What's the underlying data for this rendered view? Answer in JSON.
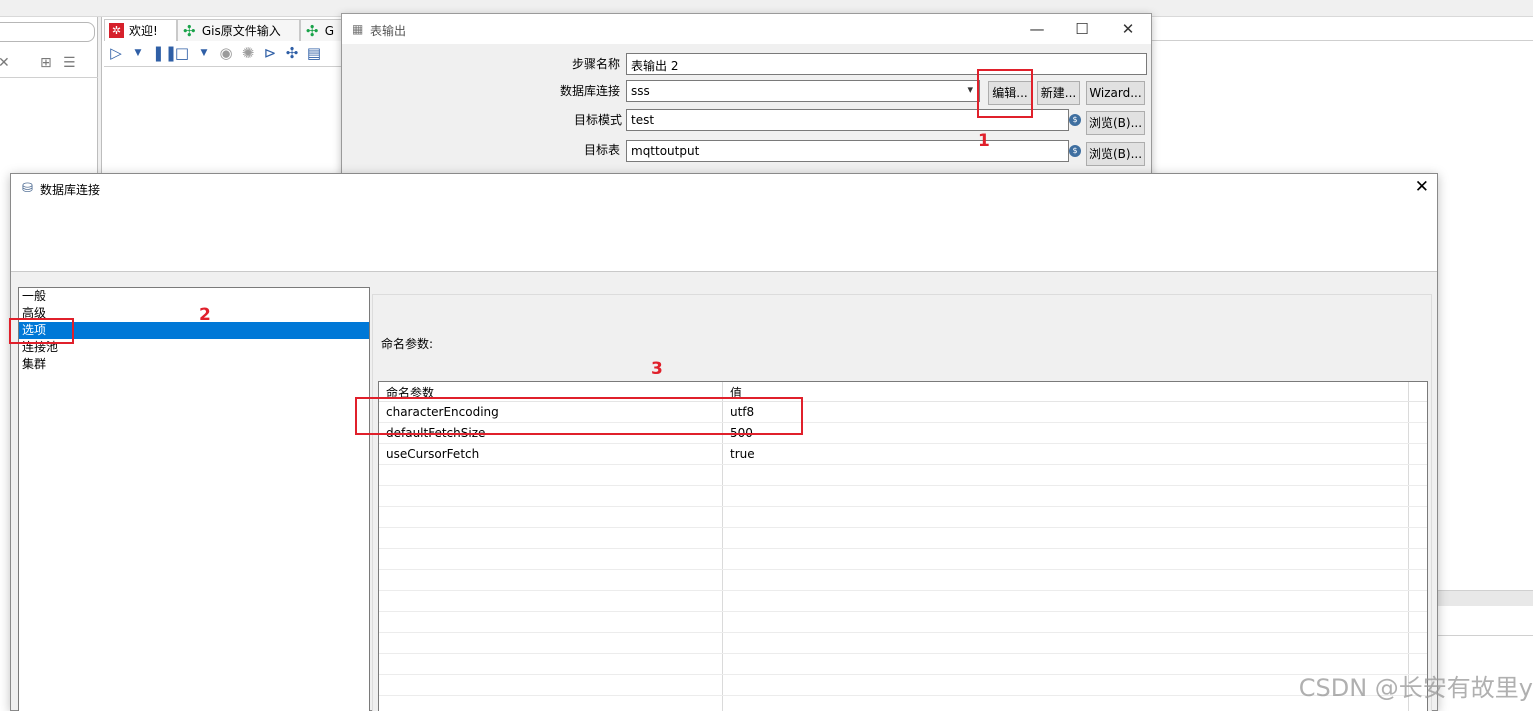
{
  "background": {
    "tabs": [
      {
        "label": "欢迎!",
        "icon": "spoon-red-icon"
      },
      {
        "label": "Gis原文件输入",
        "icon": "transformation-icon"
      },
      {
        "label": "G",
        "icon": "transformation-icon"
      }
    ]
  },
  "table_output_dialog": {
    "title": "表输出",
    "step_name_label": "步骤名称",
    "step_name_value": "表输出 2",
    "db_conn_label": "数据库连接",
    "db_conn_value": "sss",
    "edit_button": "编辑...",
    "new_button": "新建...",
    "wizard_button": "Wizard...",
    "target_schema_label": "目标模式",
    "target_schema_value": "test",
    "target_table_label": "目标表",
    "target_table_value": "mqttoutput",
    "browse_button": "浏览(B)..."
  },
  "db_dialog": {
    "title": "数据库连接",
    "nav_items": [
      "一般",
      "高级",
      "选项",
      "连接池",
      "集群"
    ],
    "selected_nav": "选项",
    "named_params_label": "命名参数:",
    "grid_headers": [
      "命名参数",
      "值"
    ],
    "params": [
      {
        "name": "characterEncoding",
        "value": "utf8"
      },
      {
        "name": "defaultFetchSize",
        "value": "500"
      },
      {
        "name": "useCursorFetch",
        "value": "true"
      }
    ]
  },
  "annotations": [
    "1",
    "2",
    "3"
  ],
  "watermark": "CSDN @长安有故里y",
  "colors": {
    "accent": "#0078d7",
    "annotation": "#e0202b"
  }
}
